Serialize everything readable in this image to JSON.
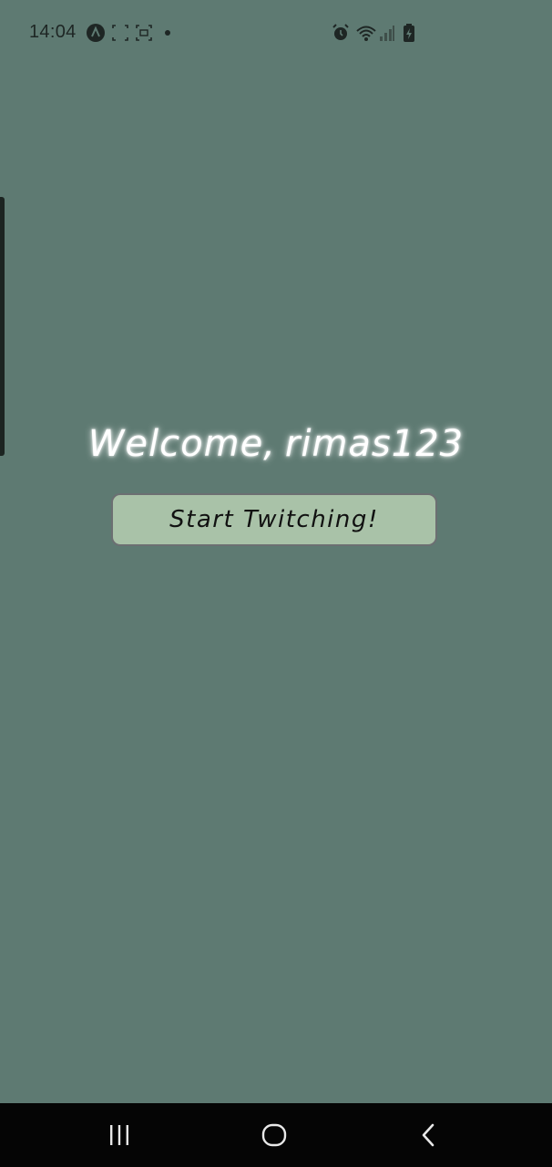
{
  "status_bar": {
    "time": "14:04",
    "icons": [
      "app-a-icon",
      "screenshot-icon",
      "scan-icon",
      "notification-dot-icon",
      "alarm-icon",
      "wifi-icon",
      "signal-icon",
      "battery-icon"
    ]
  },
  "main": {
    "welcome_prefix": "Welcome,",
    "username": "rimas123",
    "start_button_label": "Start Twitching!"
  },
  "nav_bar": {
    "buttons": [
      "recent-apps",
      "home",
      "back"
    ]
  },
  "colors": {
    "background": "#5e7a72",
    "button": "#a9c2a8",
    "nav_bar": "#050505"
  }
}
